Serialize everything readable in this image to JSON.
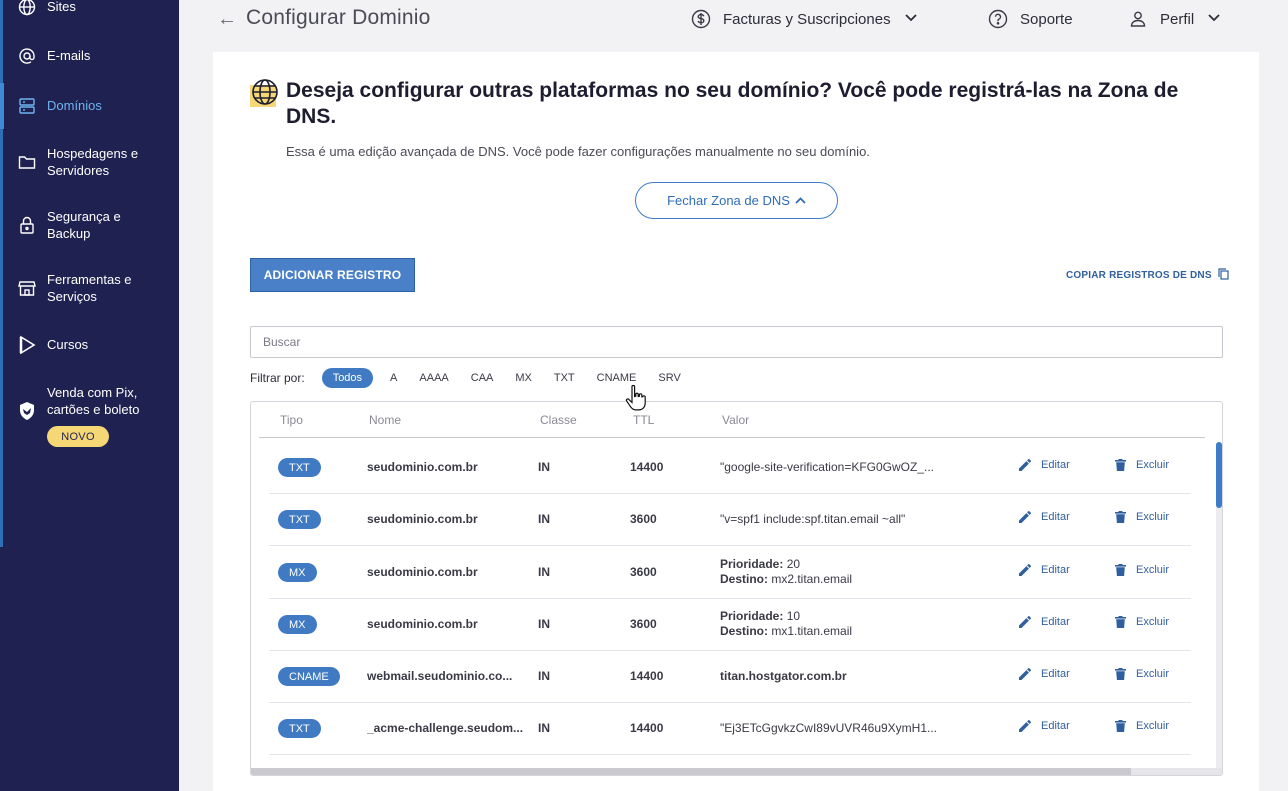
{
  "sidebar": {
    "items": [
      {
        "label": "Sites",
        "icon": "globe-icon"
      },
      {
        "label": "E-mails",
        "icon": "at-icon"
      },
      {
        "label": "Domínios",
        "icon": "server-icon"
      },
      {
        "label": "Hospedagens e Servidores",
        "icon": "folder-icon"
      },
      {
        "label": "Segurança e Backup",
        "icon": "lock-icon"
      },
      {
        "label": "Ferramentas e Serviços",
        "icon": "store-icon"
      },
      {
        "label": "Cursos",
        "icon": "play-icon"
      },
      {
        "label": "Venda com Pix, cartões e boleto",
        "icon": "shield-bird-icon"
      }
    ],
    "new_badge": "NOVO",
    "active_color": "#6fb4f2"
  },
  "header": {
    "title": "Configurar Dominio",
    "billing": "Facturas y Suscripciones",
    "support": "Soporte",
    "profile": "Perfil"
  },
  "dns": {
    "title": "Deseja configurar outras plataformas no seu domínio? Você pode registrá-las na Zona de DNS.",
    "description": "Essa é uma edição avançada de DNS. Você pode fazer configurações manualmente no seu domínio.",
    "close_button": "Fechar Zona de DNS",
    "add_button": "ADICIONAR REGISTRO",
    "copy_link": "COPIAR REGISTROS DE DNS",
    "search_placeholder": "Buscar",
    "filter_label": "Filtrar por:",
    "filters": [
      "Todos",
      "A",
      "AAAA",
      "CAA",
      "MX",
      "TXT",
      "CNAME",
      "SRV"
    ],
    "active_filter": "Todos",
    "columns": {
      "type": "Tipo",
      "name": "Nome",
      "class": "Classe",
      "ttl": "TTL",
      "value": "Valor"
    },
    "edit_label": "Editar",
    "delete_label": "Excluir",
    "records": [
      {
        "type": "TXT",
        "name": "seudominio.com.br",
        "class": "IN",
        "ttl": "14400",
        "value": "\"google-site-verification=KFG0GwOZ_..."
      },
      {
        "type": "TXT",
        "name": "seudominio.com.br",
        "class": "IN",
        "ttl": "3600",
        "value": "\"v=spf1 include:spf.titan.email ~all\""
      },
      {
        "type": "MX",
        "name": "seudominio.com.br",
        "class": "IN",
        "ttl": "3600",
        "priority_label": "Prioridade:",
        "priority": "20",
        "dest_label": "Destino:",
        "dest": "mx2.titan.email"
      },
      {
        "type": "MX",
        "name": "seudominio.com.br",
        "class": "IN",
        "ttl": "3600",
        "priority_label": "Prioridade:",
        "priority": "10",
        "dest_label": "Destino:",
        "dest": "mx1.titan.email"
      },
      {
        "type": "CNAME",
        "name": "webmail.seudominio.co...",
        "class": "IN",
        "ttl": "14400",
        "value": "titan.hostgator.com.br"
      },
      {
        "type": "TXT",
        "name": "_acme-challenge.seudom...",
        "class": "IN",
        "ttl": "14400",
        "value": "\"Ej3ETcGgvkzCwI89vUVR46u9XymH1..."
      }
    ]
  },
  "colors": {
    "sidebar_bg": "#1f2150",
    "primary": "#3f7ac3",
    "badge": "#f6d776"
  }
}
